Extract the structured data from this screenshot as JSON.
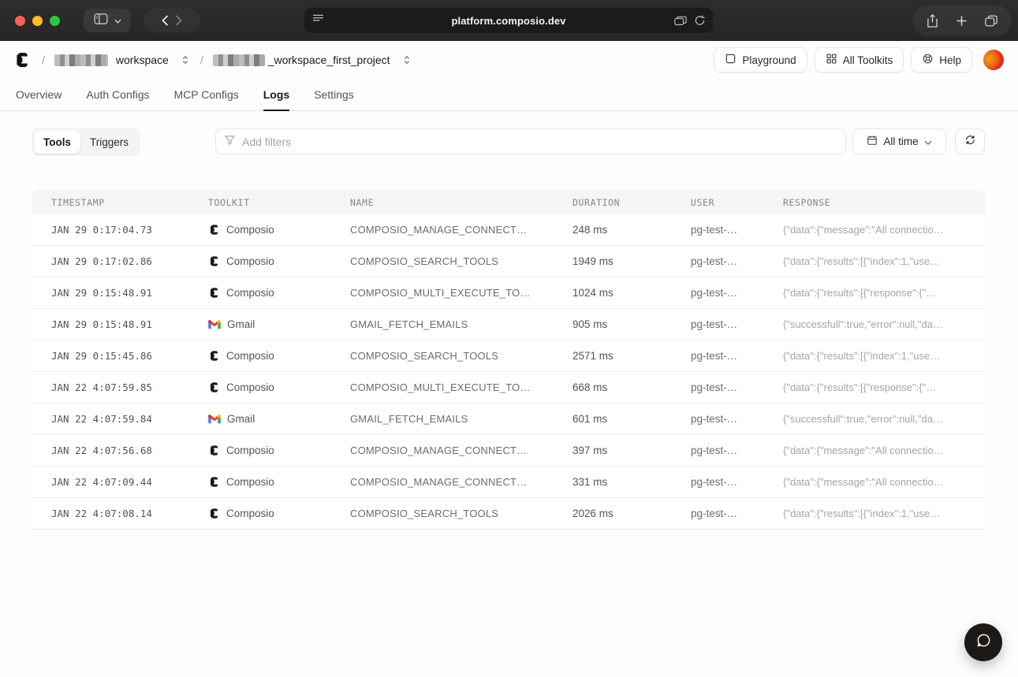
{
  "colors": {
    "brand_black": "#1c1917",
    "chrome_bg": "#282828",
    "table_header_bg": "#f5f5f4",
    "traffic_red": "#ff5f57",
    "traffic_yellow": "#febc2e",
    "traffic_green": "#28c840",
    "avatar_gradient": [
      "#f59e0b",
      "#c81e1e"
    ]
  },
  "browser": {
    "url": "platform.composio.dev"
  },
  "header": {
    "breadcrumb": {
      "separator": "/",
      "workspace_label": "workspace",
      "project_label": "_workspace_first_project"
    },
    "actions": {
      "playground": "Playground",
      "all_toolkits": "All Toolkits",
      "help": "Help"
    }
  },
  "tabs": [
    {
      "label": "Overview",
      "active": false
    },
    {
      "label": "Auth Configs",
      "active": false
    },
    {
      "label": "MCP Configs",
      "active": false
    },
    {
      "label": "Logs",
      "active": true
    },
    {
      "label": "Settings",
      "active": false
    }
  ],
  "filters": {
    "segmented": {
      "tools": "Tools",
      "triggers": "Triggers",
      "selected": "Tools"
    },
    "search_placeholder": "Add filters",
    "time_range": "All time"
  },
  "table": {
    "columns": [
      "TIMESTAMP",
      "TOOLKIT",
      "NAME",
      "DURATION",
      "USER",
      "RESPONSE"
    ],
    "rows": [
      {
        "timestamp": "JAN 29 0:17:04.73",
        "toolkit": "Composio",
        "name": "COMPOSIO_MANAGE_CONNECT…",
        "duration": "248 ms",
        "user": "pg-test-…",
        "response": "{\"data\":{\"message\":\"All connectio…"
      },
      {
        "timestamp": "JAN 29 0:17:02.86",
        "toolkit": "Composio",
        "name": "COMPOSIO_SEARCH_TOOLS",
        "duration": "1949 ms",
        "user": "pg-test-…",
        "response": "{\"data\":{\"results\":[{\"index\":1,\"use…"
      },
      {
        "timestamp": "JAN 29 0:15:48.91",
        "toolkit": "Composio",
        "name": "COMPOSIO_MULTI_EXECUTE_TO…",
        "duration": "1024 ms",
        "user": "pg-test-…",
        "response": "{\"data\":{\"results\":[{\"response\":{\"…"
      },
      {
        "timestamp": "JAN 29 0:15:48.91",
        "toolkit": "Gmail",
        "name": "GMAIL_FETCH_EMAILS",
        "duration": "905 ms",
        "user": "pg-test-…",
        "response": "{\"successfull\":true,\"error\":null,\"da…"
      },
      {
        "timestamp": "JAN 29 0:15:45.86",
        "toolkit": "Composio",
        "name": "COMPOSIO_SEARCH_TOOLS",
        "duration": "2571 ms",
        "user": "pg-test-…",
        "response": "{\"data\":{\"results\":[{\"index\":1,\"use…"
      },
      {
        "timestamp": "JAN 22 4:07:59.85",
        "toolkit": "Composio",
        "name": "COMPOSIO_MULTI_EXECUTE_TO…",
        "duration": "668 ms",
        "user": "pg-test-…",
        "response": "{\"data\":{\"results\":[{\"response\":{\"…"
      },
      {
        "timestamp": "JAN 22 4:07:59.84",
        "toolkit": "Gmail",
        "name": "GMAIL_FETCH_EMAILS",
        "duration": "601 ms",
        "user": "pg-test-…",
        "response": "{\"successfull\":true,\"error\":null,\"da…"
      },
      {
        "timestamp": "JAN 22 4:07:56.68",
        "toolkit": "Composio",
        "name": "COMPOSIO_MANAGE_CONNECT…",
        "duration": "397 ms",
        "user": "pg-test-…",
        "response": "{\"data\":{\"message\":\"All connectio…"
      },
      {
        "timestamp": "JAN 22 4:07:09.44",
        "toolkit": "Composio",
        "name": "COMPOSIO_MANAGE_CONNECT…",
        "duration": "331 ms",
        "user": "pg-test-…",
        "response": "{\"data\":{\"message\":\"All connectio…"
      },
      {
        "timestamp": "JAN 22 4:07:08.14",
        "toolkit": "Composio",
        "name": "COMPOSIO_SEARCH_TOOLS",
        "duration": "2026 ms",
        "user": "pg-test-…",
        "response": "{\"data\":{\"results\":[{\"index\":1,\"use…"
      }
    ]
  }
}
